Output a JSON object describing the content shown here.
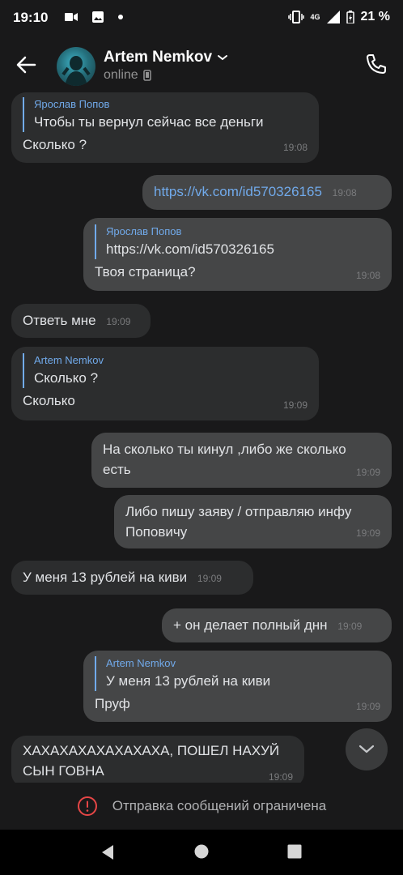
{
  "status_bar": {
    "time": "19:10",
    "network": "4G",
    "battery": "21 %"
  },
  "header": {
    "name": "Artem Nemkov",
    "status": "online"
  },
  "messages": [
    {
      "reply_author": "Ярослав Попов",
      "reply_text": "Чтобы ты вернул сейчас все деньги",
      "text": "Сколько ?",
      "time": "19:08"
    },
    {
      "text": "https://vk.com/id570326165",
      "time": "19:08"
    },
    {
      "reply_author": "Ярослав Попов",
      "reply_text": "https://vk.com/id570326165",
      "text": "Твоя страница?",
      "time": "19:08"
    },
    {
      "text": "Ответь мне",
      "time": "19:09"
    },
    {
      "reply_author": "Artem Nemkov",
      "reply_text": "Сколько ?",
      "text": "Сколько",
      "time": "19:09"
    },
    {
      "text": "На сколько ты кинул ,либо же сколько есть",
      "time": "19:09"
    },
    {
      "text": "Либо пишу заяву / отправляю инфу Поповичу",
      "time": "19:09"
    },
    {
      "text": "У меня 13 рублей на киви",
      "time": "19:09"
    },
    {
      "text": "+ он делает полный днн",
      "time": "19:09"
    },
    {
      "reply_author": "Artem Nemkov",
      "reply_text": "У меня 13 рублей на киви",
      "text": "Пруф",
      "time": "19:09"
    },
    {
      "text": "ХАХАХАХАХАХАХАХА, ПОШЕЛ НАХУЙ СЫН ГОВНА",
      "time": "19:09"
    }
  ],
  "restriction": {
    "text": "Отправка сообщений ограничена"
  },
  "colors": {
    "accent": "#71aaeb",
    "incoming_bubble": "#2c2d2e",
    "outgoing_bubble": "#454647",
    "warning": "#e64646"
  }
}
